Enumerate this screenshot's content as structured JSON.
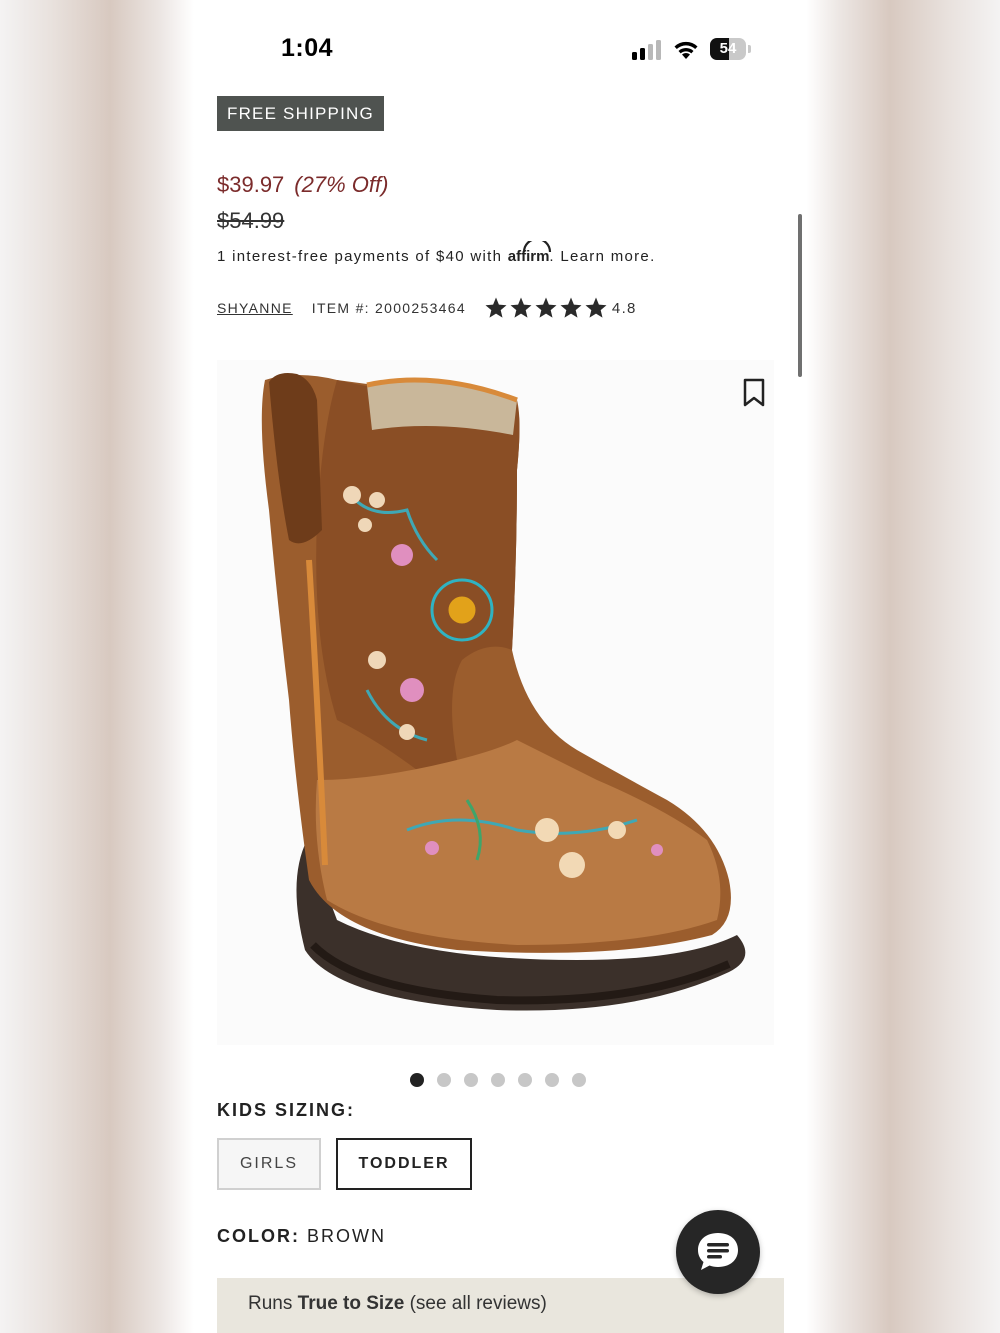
{
  "status_bar": {
    "time": "1:04",
    "battery": "54",
    "battery_level": 0.54
  },
  "promo": {
    "free_shipping": "FREE SHIPPING"
  },
  "pricing": {
    "sale_price": "$39.97",
    "discount": "(27% Off)",
    "original_price": "$54.99",
    "affirm_prefix": "1 interest-free payments of $40 with",
    "affirm_logo": "affirm",
    "affirm_suffix": ". Learn more."
  },
  "product": {
    "brand": "SHYANNE",
    "item_number": "ITEM #: 2000253464",
    "rating": "4.8",
    "rating_value": 4.8,
    "stars_total": 5,
    "image_alt": "Brown leather toddler boot with embroidered flowers",
    "image_count": 7,
    "active_image": 1
  },
  "sizing": {
    "label": "KIDS SIZING:",
    "options": [
      "GIRLS",
      "TODDLER"
    ],
    "selected": "TODDLER"
  },
  "color": {
    "label": "COLOR:",
    "value": "BROWN"
  },
  "fit": {
    "prefix": "Runs",
    "bold": "True to Size",
    "suffix": "(see all reviews)"
  },
  "colors": {
    "sale": "#7b2b2b",
    "badge_bg": "#4f5350",
    "banner_bg": "#e9e6dd",
    "chat_bg": "#262626"
  },
  "icons": {
    "bookmark": "bookmark-icon",
    "chat": "chat-icon",
    "star": "star-icon"
  }
}
